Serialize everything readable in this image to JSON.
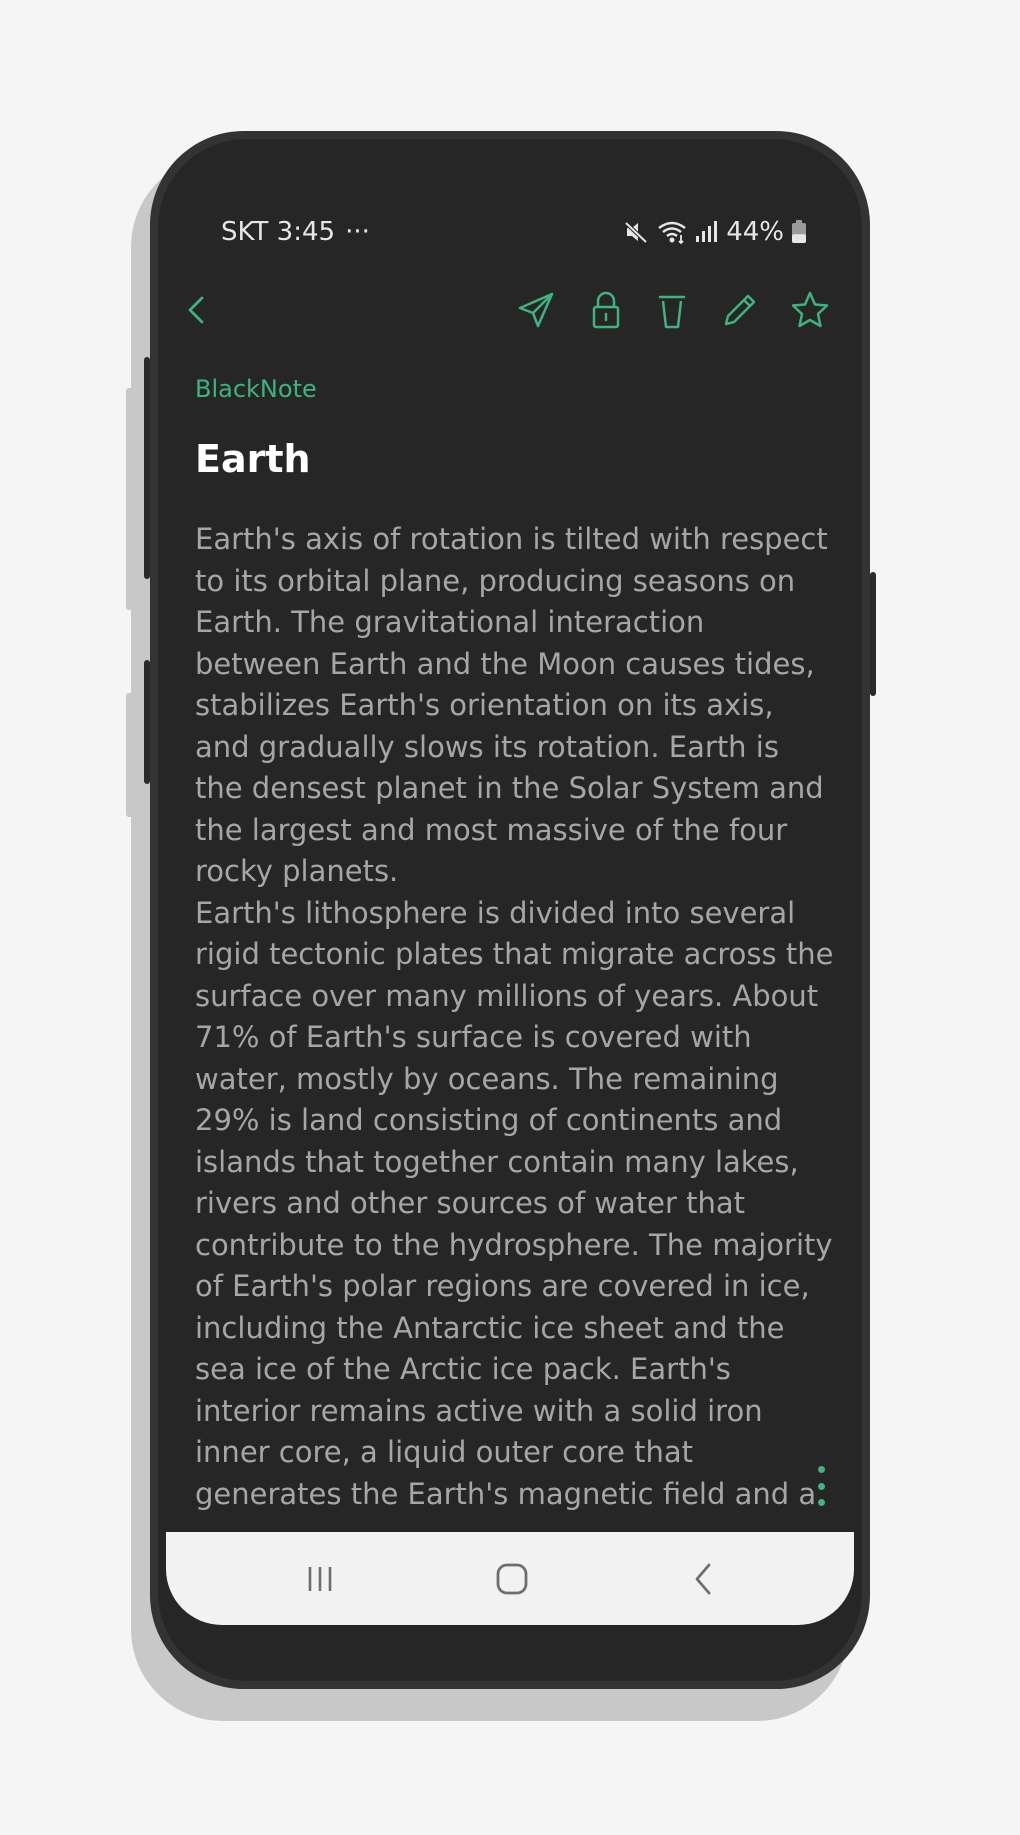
{
  "status_bar": {
    "carrier_time": "SKT 3:45",
    "more_notifications": "···",
    "battery_percent": "44%",
    "battery_level": 0.44,
    "icons": [
      "mute-icon",
      "wifi-icon",
      "signal-icon",
      "battery-icon"
    ]
  },
  "toolbar": {
    "icons": [
      "back-icon",
      "send-icon",
      "lock-icon",
      "trash-icon",
      "edit-icon",
      "star-icon"
    ]
  },
  "note": {
    "app_name": "BlackNote",
    "title": "Earth",
    "paragraphs": [
      "Earth's axis of rotation is tilted with respect to its orbital plane, producing seasons on Earth. The gravitational interaction between Earth and the Moon causes tides, stabilizes Earth's orientation on its axis, and gradually slows its rotation. Earth is the densest planet in the Solar System and the largest and most massive of the four rocky planets.",
      "Earth's lithosphere is divided into several rigid tectonic plates that migrate across the surface over many millions of years. About 71% of Earth's surface is covered with water, mostly by oceans. The remaining 29% is land consisting of continents and islands that together contain many lakes, rivers and other sources of water that contribute to the hydrosphere. The majority of Earth's polar regions are covered in ice, including the Antarctic ice sheet and the sea ice of the Arctic ice pack. Earth's interior remains active with a solid iron inner core, a liquid outer core that generates the Earth's magnetic field and a"
    ]
  },
  "nav_bar": {
    "icons": [
      "recent-apps-icon",
      "home-icon",
      "back-nav-icon"
    ]
  },
  "colors": {
    "accent": "#3fb37f",
    "background": "#262626",
    "title": "#ffffff",
    "body_text": "#a6a6a6",
    "nav_bar": "#f2f2f2"
  }
}
